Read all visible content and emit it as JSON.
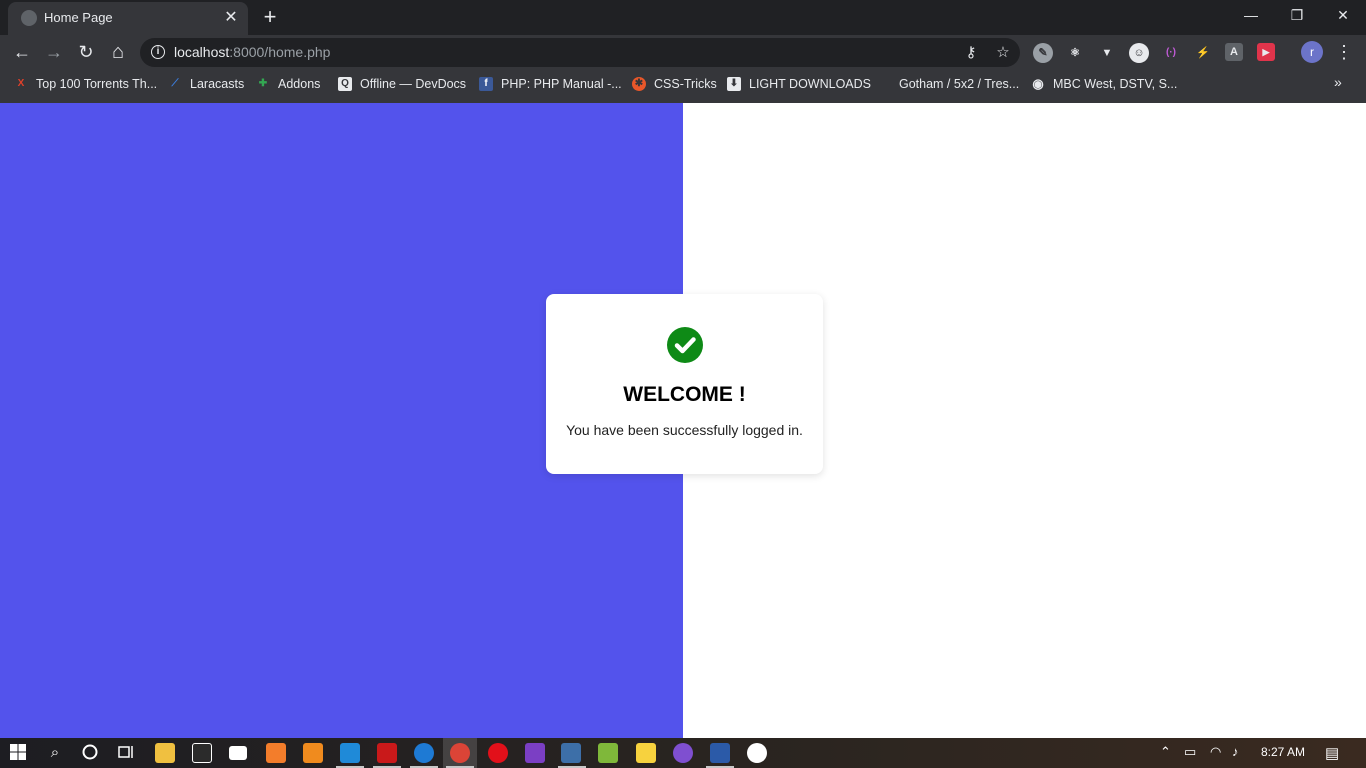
{
  "tab": {
    "title": "Home Page",
    "close": "✕",
    "new_tab": "+"
  },
  "window": {
    "minimize": "—",
    "restore": "❐",
    "close": "✕"
  },
  "nav": {
    "back": "←",
    "forward": "→",
    "reload": "↻",
    "home": "⌂"
  },
  "omnibox": {
    "host": "localhost",
    "rest": ":8000/home.php",
    "info": "i",
    "key": "⚷",
    "star": "☆"
  },
  "extensions": [
    "✎",
    "⚛",
    "▼",
    "☺",
    "(·)",
    "⚡",
    "A",
    "▶"
  ],
  "profile": {
    "initial": "r",
    "menu": "⋮"
  },
  "bookmarks": [
    {
      "label": "Top 100 Torrents Th...",
      "icon": "X",
      "color": "#e0402a"
    },
    {
      "label": "Laracasts",
      "icon": "⟋",
      "color": "#3b7ddd"
    },
    {
      "label": "Addons",
      "icon": "✚",
      "color": "#33a852"
    },
    {
      "label": "Offline — DevDocs",
      "icon": "Q",
      "color": "#9aa0a6"
    },
    {
      "label": "PHP: PHP Manual -...",
      "icon": "f",
      "color": "#3b5998"
    },
    {
      "label": "CSS-Tricks",
      "icon": "✱",
      "color": "#e8572a"
    },
    {
      "label": "LIGHT DOWNLOADS",
      "icon": "⬇",
      "color": "#5f6368"
    },
    {
      "label": "Gotham / 5x2 / Tres...",
      "icon": "",
      "color": "#35363a"
    },
    {
      "label": "MBC West, DSTV, S...",
      "icon": "◉",
      "color": "#e8eaed"
    }
  ],
  "bookmarks_more": "»",
  "card": {
    "icon": "check-circle",
    "title": "WELCOME !",
    "message": "You have been successfully logged in."
  },
  "colors": {
    "left_panel": "#5353ec",
    "check": "#0e8a16"
  },
  "taskbar": {
    "time": "8:27 AM",
    "apps": [
      "file-explorer",
      "store",
      "mail",
      "xampp",
      "sublime",
      "vscode",
      "acrobat",
      "edge",
      "chrome",
      "opera",
      "visual-studio",
      "sticky",
      "terminal",
      "notes",
      "discord",
      "word",
      "paint"
    ]
  }
}
